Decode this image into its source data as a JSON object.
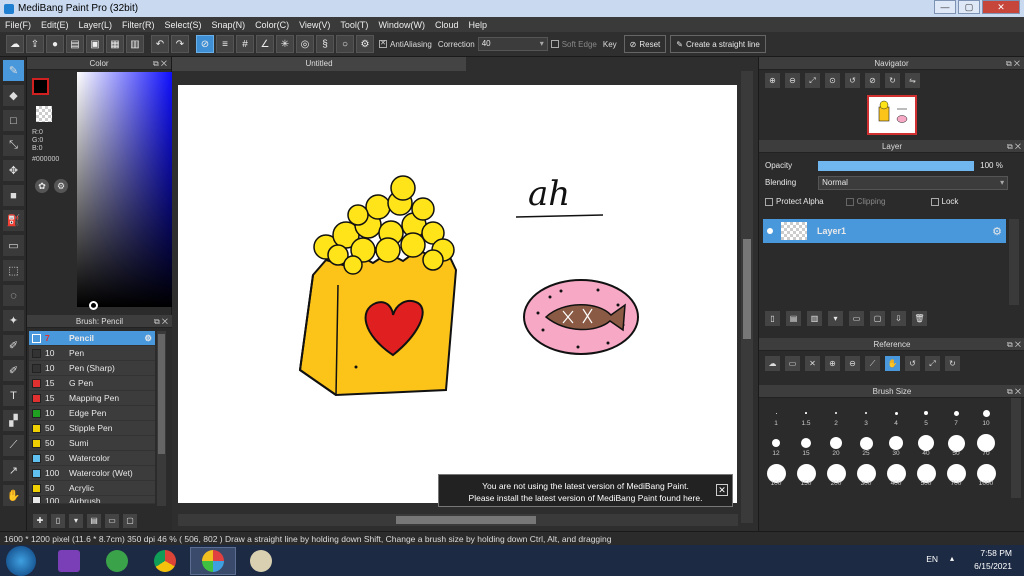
{
  "window": {
    "title": "MediBang Paint Pro (32bit)",
    "controls": [
      "—",
      "▢",
      "✕"
    ]
  },
  "menu": [
    "File(F)",
    "Edit(E)",
    "Layer(L)",
    "Filter(R)",
    "Select(S)",
    "Snap(N)",
    "Color(C)",
    "View(V)",
    "Tool(T)",
    "Window(W)",
    "Cloud",
    "Help"
  ],
  "toolbar": {
    "antialiasing": "AntiAliasing",
    "correction_label": "Correction",
    "correction_value": "40",
    "soft_edge": "Soft Edge",
    "key_label": "Key",
    "reset": "Reset",
    "straight_line": "Create a straight line"
  },
  "color_panel": {
    "title": "Color",
    "r": "R:0",
    "g": "G:0",
    "b": "B:0",
    "hex": "#000000",
    "primary": "#000000",
    "hue_selected": "#0000ff"
  },
  "brush_panel": {
    "title": "Brush: Pencil",
    "brushes": [
      {
        "size": "7",
        "name": "Pencil",
        "color": "#4a98dc"
      },
      {
        "size": "10",
        "name": "Pen",
        "color": "#333333"
      },
      {
        "size": "10",
        "name": "Pen (Sharp)",
        "color": "#333333"
      },
      {
        "size": "15",
        "name": "G Pen",
        "color": "#e03030"
      },
      {
        "size": "15",
        "name": "Mapping Pen",
        "color": "#e03030"
      },
      {
        "size": "10",
        "name": "Edge Pen",
        "color": "#20a020"
      },
      {
        "size": "50",
        "name": "Stipple Pen",
        "color": "#f0d000"
      },
      {
        "size": "50",
        "name": "Sumi",
        "color": "#f0d000"
      },
      {
        "size": "50",
        "name": "Watercolor",
        "color": "#60c0f0"
      },
      {
        "size": "100",
        "name": "Watercolor (Wet)",
        "color": "#60c0f0"
      },
      {
        "size": "50",
        "name": "Acrylic",
        "color": "#f0d000"
      },
      {
        "size": "100",
        "name": "Airbrush",
        "color": "#e8e8e8"
      }
    ]
  },
  "canvas": {
    "tab": "Untitled",
    "handwriting": "ah",
    "notice_line1": "You are not using the latest version of MediBang Paint.",
    "notice_line2": "Please install the latest version of MediBang Paint found here."
  },
  "navigator": {
    "title": "Navigator"
  },
  "layer_panel": {
    "title": "Layer",
    "opacity_label": "Opacity",
    "opacity_value": "100 %",
    "opacity_fraction": 1.0,
    "blending_label": "Blending",
    "blending_value": "Normal",
    "protect_alpha": "Protect Alpha",
    "clipping": "Clipping",
    "lock": "Lock",
    "layer_name": "Layer1"
  },
  "reference": {
    "title": "Reference"
  },
  "brush_size": {
    "title": "Brush Size",
    "sizes": [
      "1",
      "1.5",
      "2",
      "3",
      "4",
      "5",
      "7",
      "10",
      "12",
      "15",
      "20",
      "25",
      "30",
      "40",
      "50",
      "70",
      "100",
      "150",
      "200",
      "300",
      "400",
      "500",
      "700",
      "1000"
    ]
  },
  "status": "1600 * 1200 pixel   (11.6 * 8.7cm)   350 dpi   46 %   ( 506, 802 )   Draw a straight line by holding down Shift, Change a brush size by holding down Ctrl, Alt, and dragging",
  "taskbar": {
    "lang": "EN",
    "time": "7:58 PM",
    "date": "6/15/2021"
  }
}
